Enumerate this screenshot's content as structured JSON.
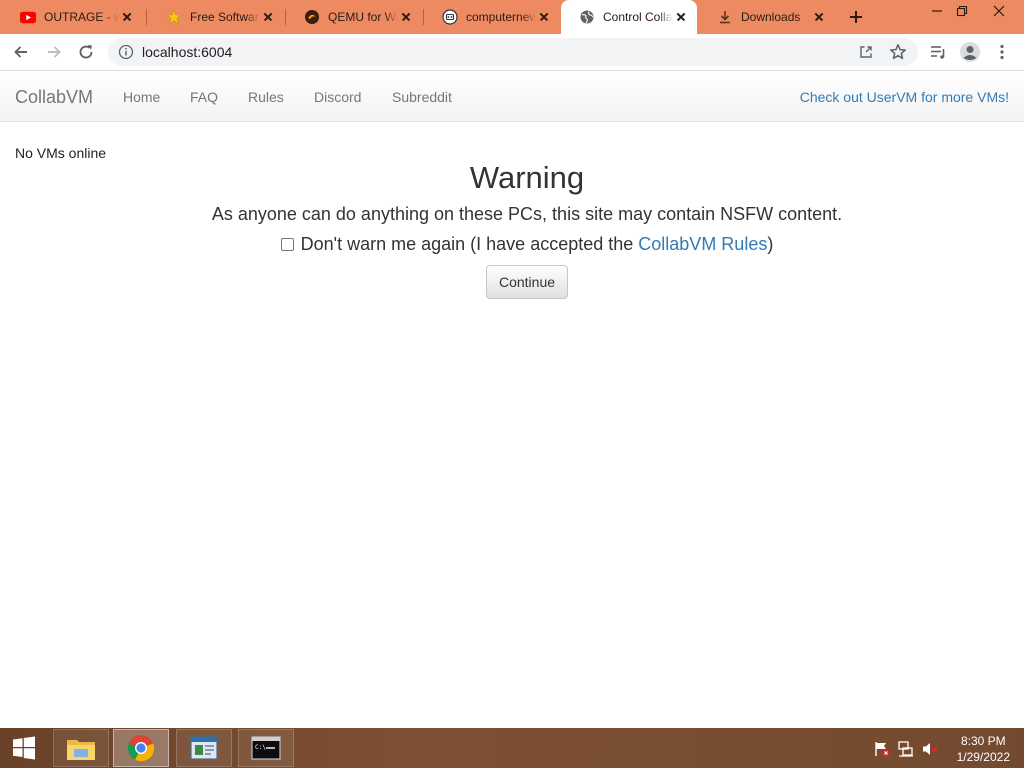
{
  "browser": {
    "tabs": [
      {
        "label": "OUTRAGE - w",
        "icon": "youtube-icon",
        "active": false
      },
      {
        "label": "Free Software",
        "icon": "star-icon",
        "active": false
      },
      {
        "label": "QEMU for Wi",
        "icon": "qemu-icon",
        "active": false
      },
      {
        "label": "computernew",
        "icon": "robot-icon",
        "active": false
      },
      {
        "label": "Control Colla",
        "icon": "globe-icon",
        "active": true
      },
      {
        "label": "Downloads",
        "icon": "download-icon",
        "active": false
      }
    ],
    "address": "localhost:6004",
    "tab_bar_color": "#ee8a62"
  },
  "navbar": {
    "brand": "CollabVM",
    "links": [
      "Home",
      "FAQ",
      "Rules",
      "Discord",
      "Subreddit"
    ],
    "right_link": "Check out UserVM for more VMs!"
  },
  "content": {
    "vm_status": "No VMs online",
    "warning_title": "Warning",
    "warning_message": "As anyone can do anything on these PCs, this site may contain NSFW content.",
    "checkbox_label_before": "Don't warn me again (I have accepted the ",
    "checkbox_link": "CollabVM Rules",
    "checkbox_label_after": ")",
    "checkbox_checked": false,
    "continue_label": "Continue"
  },
  "taskbar": {
    "items": [
      "start-icon",
      "file-explorer-icon",
      "chrome-icon",
      "app-window-icon",
      "command-prompt-icon"
    ],
    "time": "8:30 PM",
    "date": "1/29/2022"
  }
}
